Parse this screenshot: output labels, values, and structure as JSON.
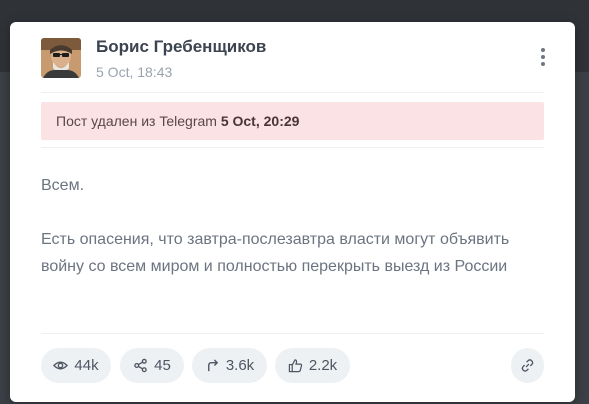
{
  "post": {
    "author": "Борис Гребенщиков",
    "timestamp": "5 Oct, 18:43",
    "deleted_notice": {
      "prefix": "Пост удален из Telegram",
      "datetime": "5 Oct, 20:29"
    },
    "paragraphs": [
      "Всем.",
      "Есть опасения, что завтра-послезавтра власти могут объявить войну со всем миром и полностью перекрыть выезд из России"
    ]
  },
  "stats": {
    "views": "44k",
    "shares": "45",
    "forwards": "3.6k",
    "reactions": "2.2k"
  },
  "icons": {
    "views": "eye-icon",
    "shares": "share-nodes-icon",
    "forwards": "forward-arrow-icon",
    "reactions": "thumbs-up-icon",
    "link": "link-icon",
    "menu": "more-vertical-icon"
  },
  "colors": {
    "deleted_background": "#fbe2e4",
    "stat_background": "#eef1f4",
    "page_background": "#2f3338"
  }
}
